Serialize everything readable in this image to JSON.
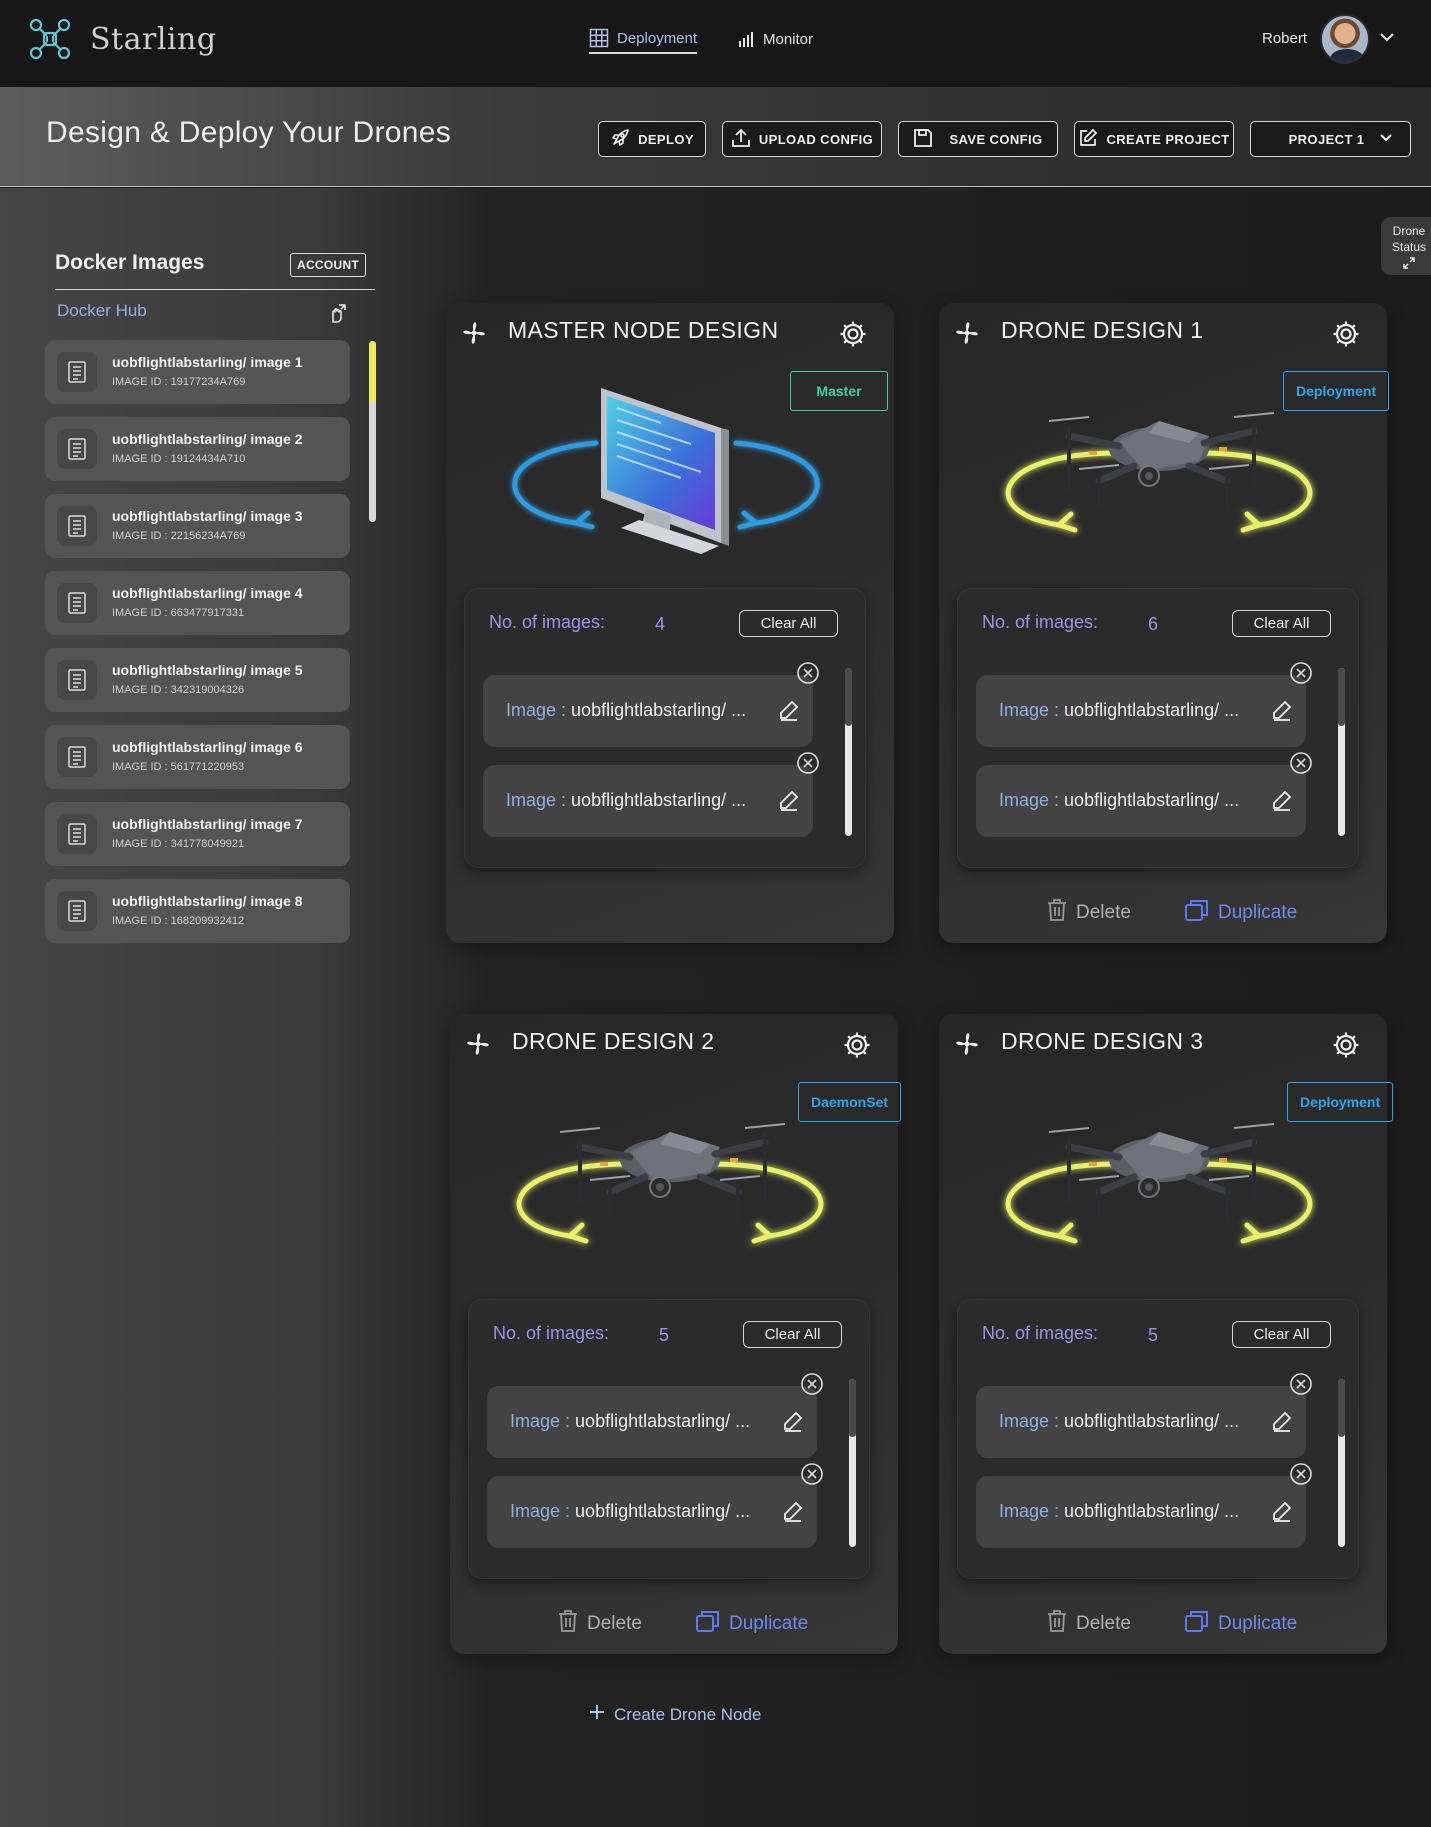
{
  "app": {
    "brand": "Starling"
  },
  "nav": {
    "tabs": [
      {
        "label": "Deployment",
        "active": true,
        "icon": "grid-icon"
      },
      {
        "label": "Monitor",
        "active": false,
        "icon": "bar-chart-icon"
      }
    ],
    "user": {
      "name": "Robert"
    }
  },
  "header": {
    "title": "Design & Deploy Your Drones",
    "buttons": {
      "deploy": "DEPLOY",
      "upload": "UPLOAD CONFIG",
      "save": "SAVE CONFIG",
      "create": "CREATE PROJECT",
      "project": "PROJECT 1"
    }
  },
  "sidebar": {
    "title": "Docker Images",
    "account": "ACCOUNT",
    "source": "Docker Hub",
    "images": [
      {
        "name": "uobflightlabstarling/ image 1",
        "id": "IMAGE ID : 19177234A769"
      },
      {
        "name": "uobflightlabstarling/ image 2",
        "id": "IMAGE ID : 19124434A710"
      },
      {
        "name": "uobflightlabstarling/ image 3",
        "id": "IMAGE ID : 22156234A769"
      },
      {
        "name": "uobflightlabstarling/ image 4",
        "id": "IMAGE ID : 663477917331"
      },
      {
        "name": "uobflightlabstarling/ image 5",
        "id": "IMAGE ID : 342319004326"
      },
      {
        "name": "uobflightlabstarling/ image 6",
        "id": "IMAGE ID : 561771220953"
      },
      {
        "name": "uobflightlabstarling/ image 7",
        "id": "IMAGE ID : 341778049921"
      },
      {
        "name": "uobflightlabstarling/ image 8",
        "id": "IMAGE ID : 168209932412"
      }
    ]
  },
  "status_tab": {
    "line1": "Drone",
    "line2": "Status"
  },
  "cards": [
    {
      "title": "MASTER NODE DESIGN",
      "role": "Master",
      "role_color": "#3fd1a6",
      "count_label": "No. of images:",
      "count": "4",
      "clear": "Clear All",
      "entries": [
        {
          "label": "Image :",
          "value": "uobflightlabstarling/ ..."
        },
        {
          "label": "Image :",
          "value": "uobflightlabstarling/ ..."
        }
      ],
      "visual": "monitor",
      "ring_color": "#2f9ae0"
    },
    {
      "title": "DRONE DESIGN  1",
      "role": "Deployment",
      "role_color": "#2fa6e8",
      "count_label": "No. of images:",
      "count": "6",
      "clear": "Clear All",
      "entries": [
        {
          "label": "Image :",
          "value": "uobflightlabstarling/ ..."
        },
        {
          "label": "Image :",
          "value": "uobflightlabstarling/ ..."
        }
      ],
      "visual": "drone",
      "ring_color": "#e9f06a",
      "delete": "Delete",
      "duplicate": "Duplicate"
    },
    {
      "title": "DRONE DESIGN  2",
      "role": "DaemonSet",
      "role_color": "#2fa6e8",
      "count_label": "No. of images:",
      "count": "5",
      "clear": "Clear All",
      "entries": [
        {
          "label": "Image :",
          "value": "uobflightlabstarling/ ..."
        },
        {
          "label": "Image :",
          "value": "uobflightlabstarling/ ..."
        }
      ],
      "visual": "drone",
      "ring_color": "#e9f06a",
      "delete": "Delete",
      "duplicate": "Duplicate"
    },
    {
      "title": "DRONE DESIGN  3",
      "role": "Deployment",
      "role_color": "#2fa6e8",
      "count_label": "No. of images:",
      "count": "5",
      "clear": "Clear All",
      "entries": [
        {
          "label": "Image :",
          "value": "uobflightlabstarling/ ..."
        },
        {
          "label": "Image :",
          "value": "uobflightlabstarling/ ..."
        }
      ],
      "visual": "drone",
      "ring_color": "#e9f06a",
      "delete": "Delete",
      "duplicate": "Duplicate"
    }
  ],
  "create_node": "Create Drone Node",
  "colors": {
    "accent_blue": "#8fb2e2",
    "duplicate_blue": "#5b7cf0",
    "count_purple": "#9a95e8",
    "scroll_yellow": "#f1e85a"
  }
}
